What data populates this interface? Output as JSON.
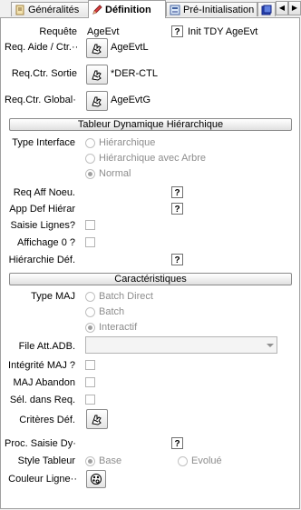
{
  "tabs": [
    {
      "label": "Généralités"
    },
    {
      "label": "Définition",
      "active": true
    },
    {
      "label": "Pré-Initialisation"
    }
  ],
  "header": {
    "requete_label": "Requête",
    "requete_value": "AgeEvt",
    "help": "?",
    "init_label": "Init TDY AgeEvt"
  },
  "fields": {
    "req_aide_label": "Req. Aide / Ctr.··",
    "req_aide_value": "AgeEvtL",
    "req_sortie_label": "Req.Ctr. Sortie",
    "req_sortie_value": "*DER-CTL",
    "req_global_label": "Req.Ctr. Global··",
    "req_global_value": "AgeEvtG"
  },
  "tableur": {
    "title": "Tableur Dynamique Hiérarchique",
    "type_interface_label": "Type Interface",
    "options": [
      "Hiérarchique",
      "Hiérarchique avec Arbre",
      "Normal"
    ],
    "selected": "Normal",
    "req_aff_noeu_label": "Req Aff Noeu.",
    "app_def_hierar_label": "App Def Hiérar",
    "saisie_lignes_label": "Saisie Lignes?",
    "affichage_zero_label": "Affichage 0 ?",
    "hierarchie_def_label": "Hiérarchie Déf."
  },
  "caracteristiques": {
    "title": "Caractéristiques",
    "type_maj_label": "Type MAJ",
    "options": [
      "Batch Direct",
      "Batch",
      "Interactif"
    ],
    "selected": "Interactif",
    "file_att_label": "File Att.ADB.",
    "file_att_value": "",
    "integrite_label": "Intégrité MAJ ?",
    "maj_abandon_label": "MAJ Abandon",
    "sel_req_label": "Sél. dans Req.",
    "criteres_label": "Critères Déf.",
    "proc_saisie_label": "Proc. Saisie Dy··",
    "style_tableur_label": "Style Tableur",
    "style_options": [
      "Base",
      "Evolué"
    ],
    "style_selected": "Base",
    "couleur_label": "Couleur Ligne··"
  }
}
